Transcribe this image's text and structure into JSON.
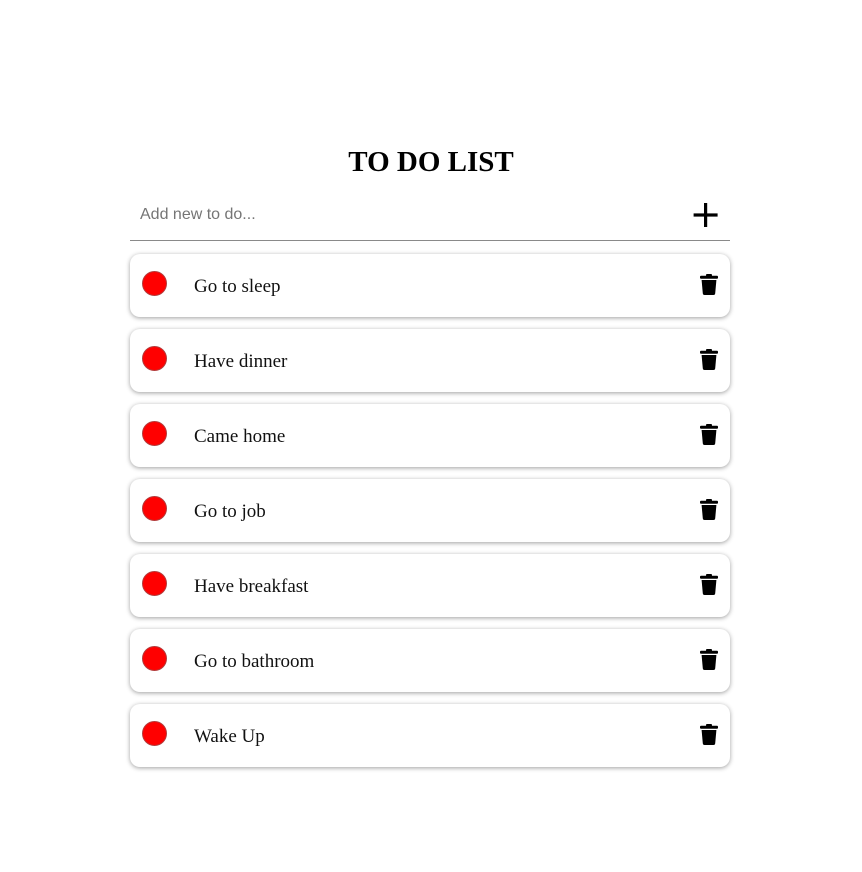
{
  "page": {
    "title": "TO DO LIST"
  },
  "new_todo": {
    "placeholder": "Add new to do...",
    "value": "",
    "add_icon": "plus-icon"
  },
  "todos": [
    {
      "text": "Go to sleep",
      "done": false,
      "status_color": "#ff0000",
      "delete_icon": "trash-icon"
    },
    {
      "text": "Have dinner",
      "done": false,
      "status_color": "#ff0000",
      "delete_icon": "trash-icon"
    },
    {
      "text": "Came home",
      "done": false,
      "status_color": "#ff0000",
      "delete_icon": "trash-icon"
    },
    {
      "text": "Go to job",
      "done": false,
      "status_color": "#ff0000",
      "delete_icon": "trash-icon"
    },
    {
      "text": "Have breakfast",
      "done": false,
      "status_color": "#ff0000",
      "delete_icon": "trash-icon"
    },
    {
      "text": "Go to bathroom",
      "done": false,
      "status_color": "#ff0000",
      "delete_icon": "trash-icon"
    },
    {
      "text": "Wake Up",
      "done": false,
      "status_color": "#ff0000",
      "delete_icon": "trash-icon"
    }
  ]
}
